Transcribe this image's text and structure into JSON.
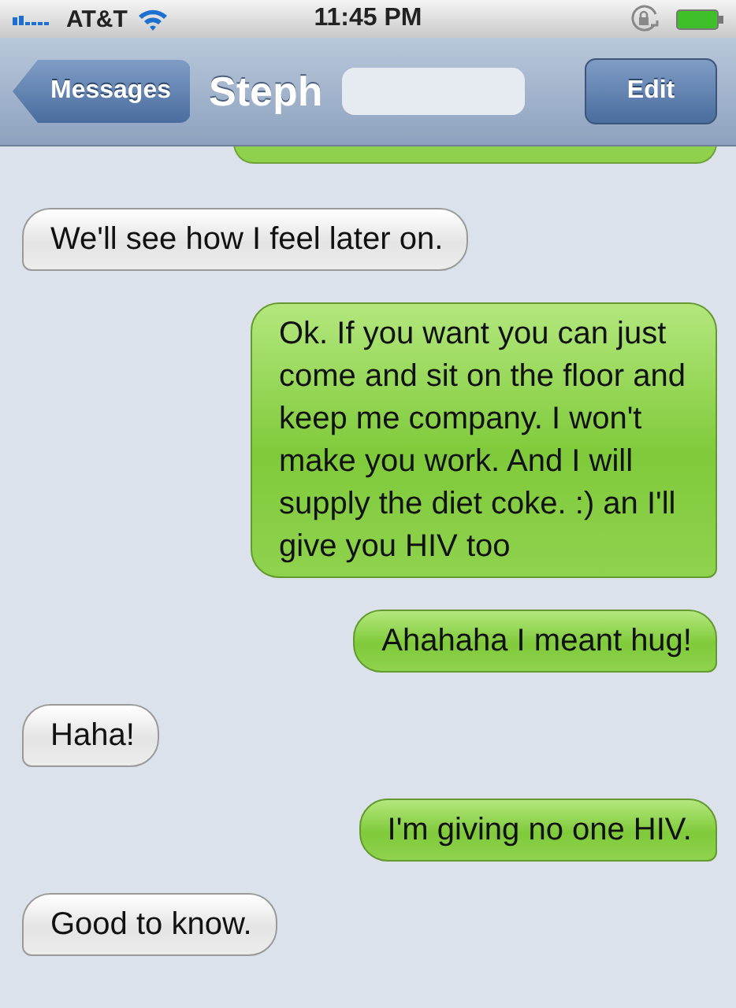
{
  "status_bar": {
    "carrier": "AT&T",
    "time": "11:45 PM"
  },
  "nav_bar": {
    "back": "Messages",
    "title": "Steph",
    "action": "Edit"
  },
  "messages": [
    {
      "kind": "received",
      "text": "We'll see how I feel later on."
    },
    {
      "kind": "sent",
      "text": "Ok. If you want you can just come and sit on the floor and keep me company. I won't make you work. And I will supply the diet coke. :) an I'll give you HIV too"
    },
    {
      "kind": "sent",
      "text": "Ahahaha I meant hug!"
    },
    {
      "kind": "received",
      "text": "Haha!"
    },
    {
      "kind": "sent",
      "text": "I'm giving no one HIV."
    },
    {
      "kind": "received",
      "text": "Good to know."
    }
  ]
}
